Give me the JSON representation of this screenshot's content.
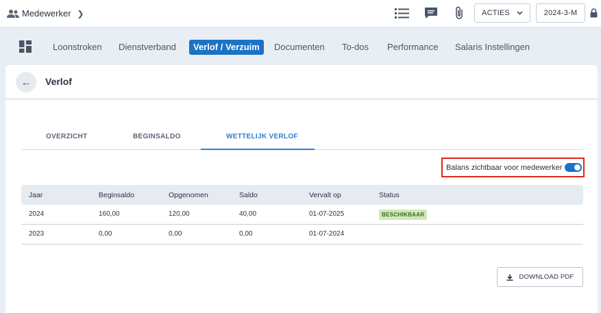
{
  "breadcrumb": {
    "label": "Medewerker"
  },
  "toolbar": {
    "acties_label": "ACTIES",
    "period_label": "2024-3-M"
  },
  "nav": {
    "tabs": [
      {
        "label": "Loonstroken"
      },
      {
        "label": "Dienstverband"
      },
      {
        "label": "Verlof / Verzuim"
      },
      {
        "label": "Documenten"
      },
      {
        "label": "To-dos"
      },
      {
        "label": "Performance"
      },
      {
        "label": "Salaris Instellingen"
      }
    ],
    "active_color": "#1a73c5"
  },
  "card": {
    "title": "Verlof"
  },
  "subtabs": [
    {
      "label": "OVERZICHT"
    },
    {
      "label": "BEGINSALDO"
    },
    {
      "label": "WETTELIJK VERLOF"
    }
  ],
  "balance_toggle": {
    "label": "Balans zichtbaar voor medewerker",
    "on": true
  },
  "table": {
    "headers": [
      "Jaar",
      "Beginsaldo",
      "Opgenomen",
      "Saldo",
      "Vervalt op",
      "Status"
    ],
    "rows": [
      {
        "jaar": "2024",
        "beginsaldo": "160,00",
        "opgenomen": "120,00",
        "saldo": "40,00",
        "vervalt_op": "01-07-2025",
        "status": "BESCHIKBAAR"
      },
      {
        "jaar": "2023",
        "beginsaldo": "0,00",
        "opgenomen": "0,00",
        "saldo": "0,00",
        "vervalt_op": "01-07-2024",
        "status": ""
      }
    ]
  },
  "download": {
    "label": "DOWNLOAD PDF"
  },
  "colors": {
    "accent": "#1a73c5",
    "highlight_border": "#e2231a",
    "badge_bg": "#cfe8b8"
  }
}
